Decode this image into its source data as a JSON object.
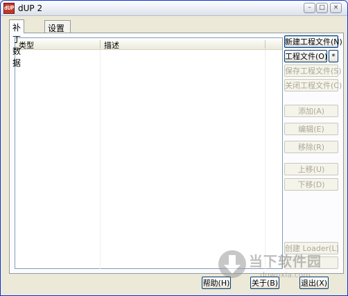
{
  "window": {
    "title": "dUP 2",
    "icon_text": "dUP",
    "controls": {
      "minimize": "–",
      "maximize": "□",
      "close": "×"
    }
  },
  "tabs": [
    {
      "label": "补丁数据",
      "active": true
    },
    {
      "label": "设置",
      "active": false
    }
  ],
  "list": {
    "columns": [
      "类型",
      "描述"
    ],
    "rows": []
  },
  "side_buttons": {
    "new_project": "新建工程文件(N)",
    "project_file": "工程文件(O)",
    "star": "*",
    "save_project": "保存工程文件(S)",
    "close_project": "关闭工程文件(C)",
    "add": "添加(A)",
    "edit": "编辑(E)",
    "remove": "移除(R)",
    "move_up": "上移(U)",
    "move_down": "下移(D)",
    "create_loader": "创建 Loader(L)",
    "extra": ""
  },
  "bottom_buttons": {
    "help": "帮助(H)",
    "about": "关于(B)",
    "exit": "退出(X)"
  },
  "watermark": {
    "title": "当下软件园",
    "url": "downxia.com"
  },
  "colors": {
    "window_bg": "#ece9d8",
    "border_blue": "#003c74",
    "disabled_text": "#aca899"
  }
}
